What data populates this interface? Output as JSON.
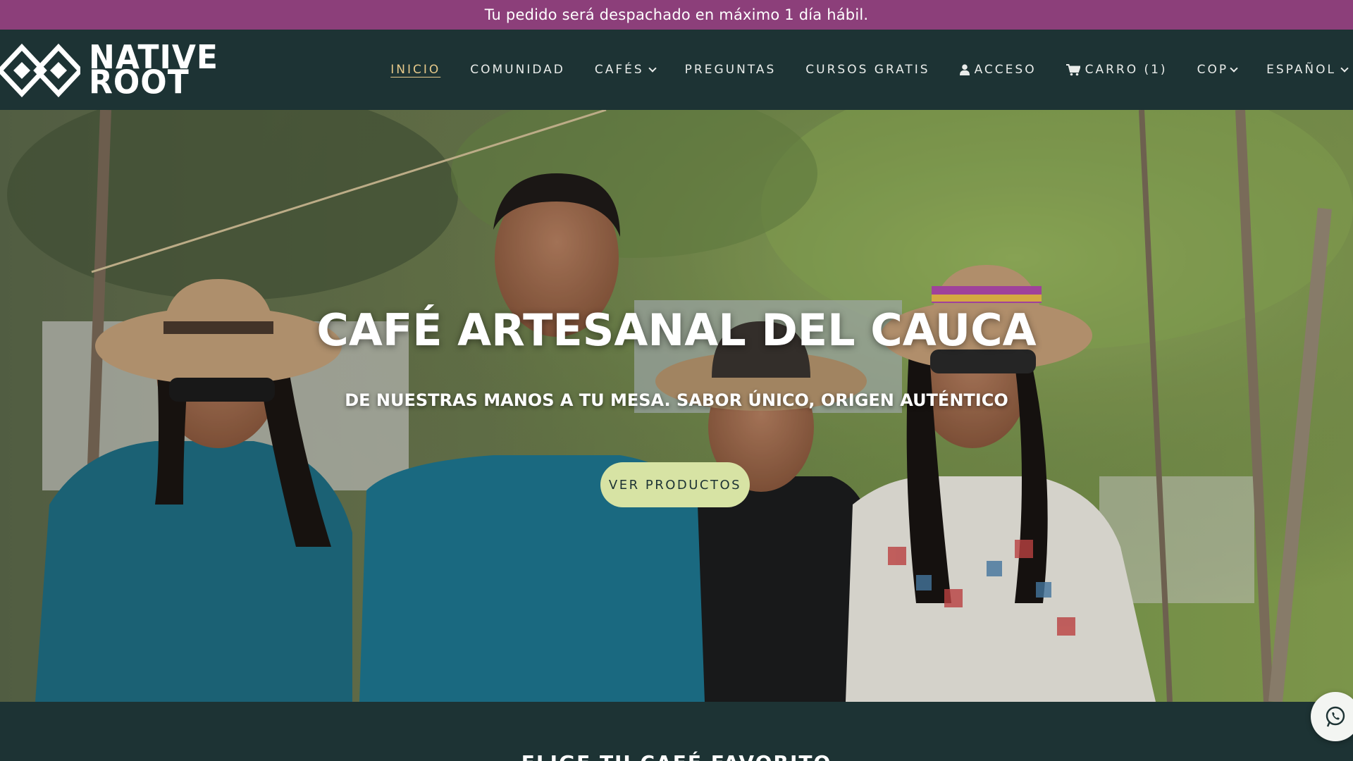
{
  "announcement": {
    "text": "Tu pedido será despachado en máximo 1 día hábil."
  },
  "brand": {
    "line1": "NATIVE",
    "line2": "ROOT"
  },
  "nav": {
    "items": [
      {
        "label": "INICIO",
        "active": true
      },
      {
        "label": "COMUNIDAD"
      },
      {
        "label": "CAFÉS",
        "dropdown": true
      },
      {
        "label": "PREGUNTAS"
      },
      {
        "label": "CURSOS GRATIS"
      },
      {
        "label": "ACCESO",
        "icon": "user-icon"
      },
      {
        "label": "CARRO (1)",
        "icon": "cart-icon"
      },
      {
        "label": "COP",
        "dropdown": true
      },
      {
        "label": "ESPAÑOL",
        "dropdown": true
      }
    ]
  },
  "hero": {
    "title": "CAFÉ ARTESANAL DEL CAUCA",
    "subtitle": "DE NUESTRAS MANOS A TU MESA. SABOR ÚNICO, ORIGEN AUTÉNTICO",
    "cta_label": "VER PRODUCTOS"
  },
  "next_section": {
    "title": "ELIGE TU CAFÉ FAVORITO"
  },
  "floating": {
    "icon": "whatsapp-icon"
  },
  "colors": {
    "announcement_bg": "#8c3f7a",
    "nav_bg": "#1d3334",
    "active_link": "#e6c98a",
    "cta_bg": "#d7e3a4"
  }
}
